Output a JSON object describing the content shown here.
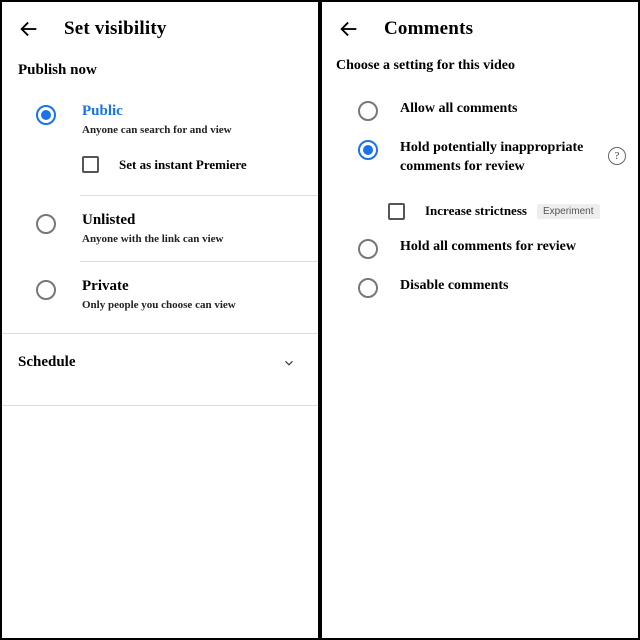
{
  "left": {
    "title": "Set visibility",
    "section": "Publish now",
    "options": [
      {
        "title": "Public",
        "desc": "Anyone can search for and view",
        "sub": "Set as instant Premiere"
      },
      {
        "title": "Unlisted",
        "desc": "Anyone with the link can view"
      },
      {
        "title": "Private",
        "desc": "Only people you choose can view"
      }
    ],
    "schedule": "Schedule"
  },
  "right": {
    "title": "Comments",
    "prompt": "Choose a setting for this video",
    "options": [
      {
        "label": "Allow all comments"
      },
      {
        "label": "Hold potentially inappropriate comments for review",
        "sub": "Increase strictness",
        "sub_badge": "Experiment"
      },
      {
        "label": "Hold all comments for review"
      },
      {
        "label": "Disable comments"
      }
    ],
    "help": "?"
  }
}
